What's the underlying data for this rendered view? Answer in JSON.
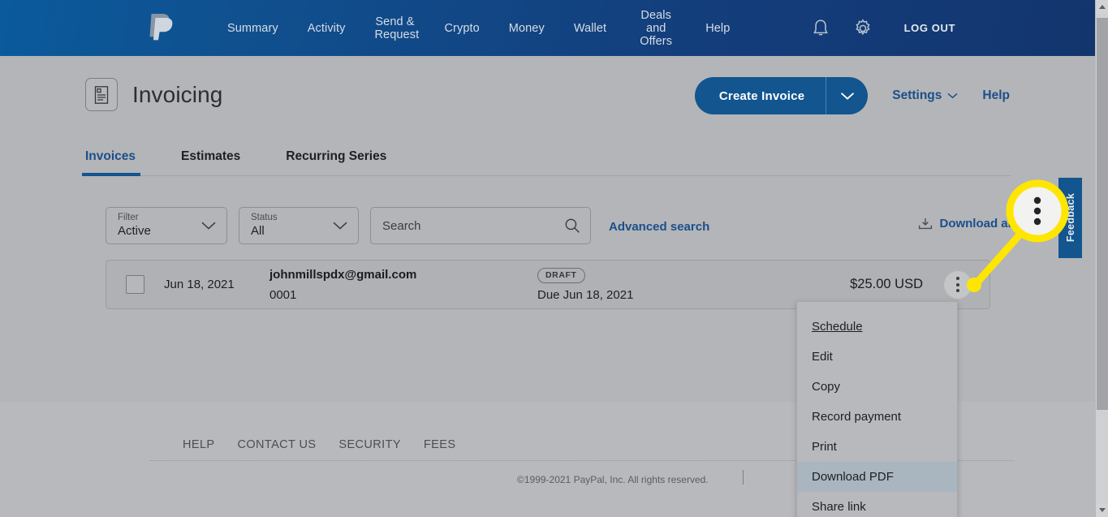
{
  "topnav": {
    "logo_name": "paypal-logo",
    "links": [
      {
        "label": "Summary",
        "two_line": false
      },
      {
        "label": "Activity",
        "two_line": false
      },
      {
        "label": "Send & Request",
        "two_line": true
      },
      {
        "label": "Crypto",
        "two_line": false
      },
      {
        "label": "Money",
        "two_line": false
      },
      {
        "label": "Wallet",
        "two_line": false
      },
      {
        "label": "Deals and Offers",
        "two_line": true
      },
      {
        "label": "Help",
        "two_line": false
      }
    ],
    "notifications_icon": "bell-icon",
    "settings_icon": "gear-icon",
    "logout_label": "LOG OUT",
    "gradient_start": "#0a5a9c",
    "gradient_end": "#13356e"
  },
  "header": {
    "icon": "invoice-document-icon",
    "title": "Invoicing",
    "create_invoice_label": "Create Invoice",
    "create_invoice_caret_icon": "chevron-down-icon",
    "settings_label": "Settings",
    "settings_caret_icon": "chevron-down-icon",
    "help_label": "Help",
    "accent_color": "#12558f",
    "link_color": "#1b4f8a"
  },
  "tabs": [
    {
      "label": "Invoices",
      "active": true
    },
    {
      "label": "Estimates",
      "active": false
    },
    {
      "label": "Recurring Series",
      "active": false
    }
  ],
  "filterbar": {
    "filter": {
      "label": "Filter",
      "value": "Active",
      "caret_icon": "chevron-down-icon"
    },
    "status": {
      "label": "Status",
      "value": "All",
      "caret_icon": "chevron-down-icon"
    },
    "search": {
      "placeholder": "Search",
      "value": "",
      "icon": "search-icon"
    },
    "advanced_search_label": "Advanced search",
    "download_all_label": "Download all",
    "download_all_icon": "download-tray-icon"
  },
  "invoice_row": {
    "checkbox_checked": false,
    "date": "Jun 18, 2021",
    "email": "johnmillspdx@gmail.com",
    "invoice_number": "0001",
    "status_badge": "DRAFT",
    "due_date": "Due Jun 18, 2021",
    "amount": "$25.00 USD",
    "kebab_icon": "kebab-menu-icon"
  },
  "kebab_menu": {
    "items": [
      {
        "label": "Schedule",
        "underlined": true,
        "highlighted": false
      },
      {
        "label": "Edit",
        "underlined": false,
        "highlighted": false
      },
      {
        "label": "Copy",
        "underlined": false,
        "highlighted": false
      },
      {
        "label": "Record payment",
        "underlined": false,
        "highlighted": false
      },
      {
        "label": "Print",
        "underlined": false,
        "highlighted": false
      },
      {
        "label": "Download PDF",
        "underlined": false,
        "highlighted": true
      },
      {
        "label": "Share link",
        "underlined": false,
        "highlighted": false
      }
    ],
    "highlight_color": "#a9b6c0"
  },
  "feedback": {
    "label": "Feedback",
    "color": "#12558f"
  },
  "callout": {
    "name": "kebab-menu-magnifier-callout",
    "icon": "kebab-menu-icon",
    "ring_color": "#ffe600",
    "fill_color": "#f2f2f0"
  },
  "footer": {
    "links": [
      "HELP",
      "CONTACT US",
      "SECURITY",
      "FEES"
    ],
    "copyright": "©1999-2021 PayPal, Inc. All rights reserved."
  },
  "scrollbar": {
    "up_icon": "scroll-up-arrow-icon",
    "down_icon": "scroll-down-arrow-icon",
    "thumb_name": "scrollbar-thumb"
  }
}
